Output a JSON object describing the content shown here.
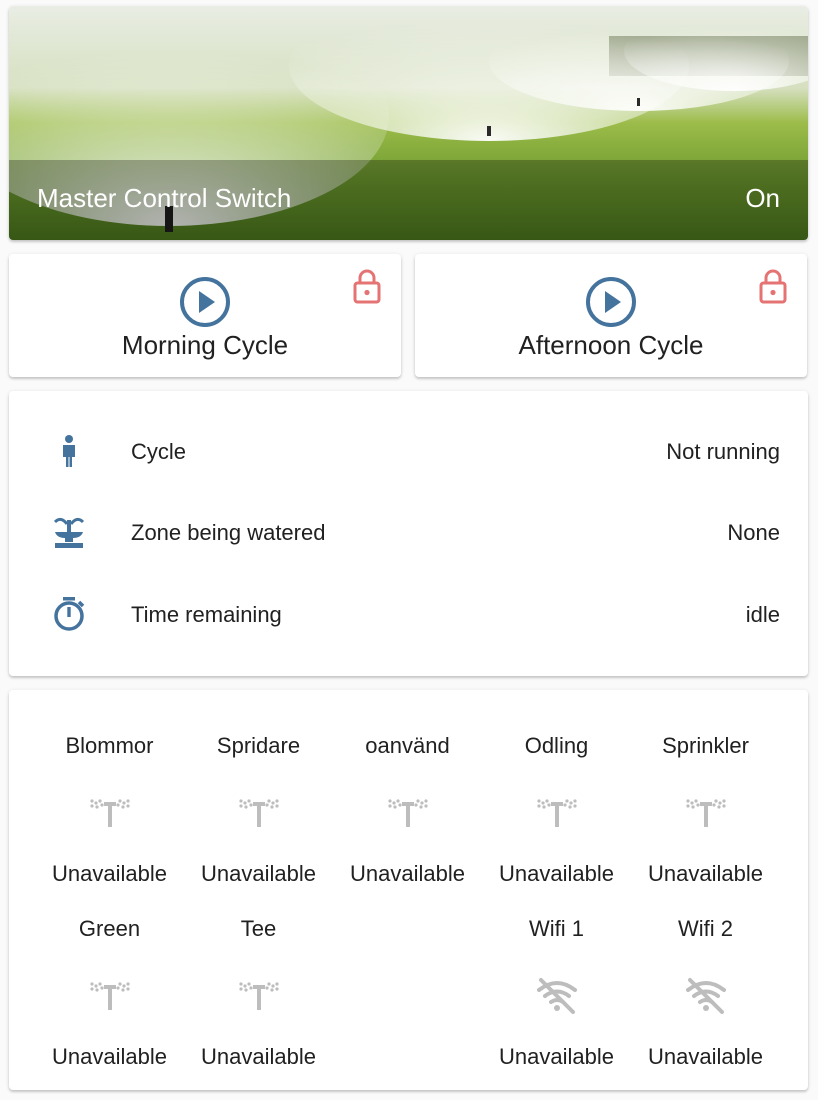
{
  "hero": {
    "title": "Master Control Switch",
    "state": "On"
  },
  "cycles": [
    {
      "label": "Morning Cycle",
      "icon": "play-circle-icon",
      "lock_icon": "lock-icon"
    },
    {
      "label": "Afternoon Cycle",
      "icon": "play-circle-icon",
      "lock_icon": "lock-icon"
    }
  ],
  "status": [
    {
      "icon": "person-icon",
      "label": "Cycle",
      "value": "Not running"
    },
    {
      "icon": "fountain-icon",
      "label": "Zone being watered",
      "value": "None"
    },
    {
      "icon": "timer-icon",
      "label": "Time remaining",
      "value": "idle"
    }
  ],
  "entities": [
    {
      "name": "Blommor",
      "state": "Unavailable",
      "icon": "sprinkler-icon"
    },
    {
      "name": "Spridare",
      "state": "Unavailable",
      "icon": "sprinkler-icon"
    },
    {
      "name": "oanvänd",
      "state": "Unavailable",
      "icon": "sprinkler-icon"
    },
    {
      "name": "Odling",
      "state": "Unavailable",
      "icon": "sprinkler-icon"
    },
    {
      "name": "Sprinkler",
      "state": "Unavailable",
      "icon": "sprinkler-icon"
    },
    {
      "name": "Green",
      "state": "Unavailable",
      "icon": "sprinkler-icon"
    },
    {
      "name": "Tee",
      "state": "Unavailable",
      "icon": "sprinkler-icon"
    },
    {
      "name": "Wifi 1",
      "state": "Unavailable",
      "icon": "wifi-off-icon"
    },
    {
      "name": "Wifi 2",
      "state": "Unavailable",
      "icon": "wifi-off-icon"
    }
  ],
  "colors": {
    "accent": "#44739e",
    "lock": "#e57373",
    "unavailable": "#bdbdbd"
  }
}
